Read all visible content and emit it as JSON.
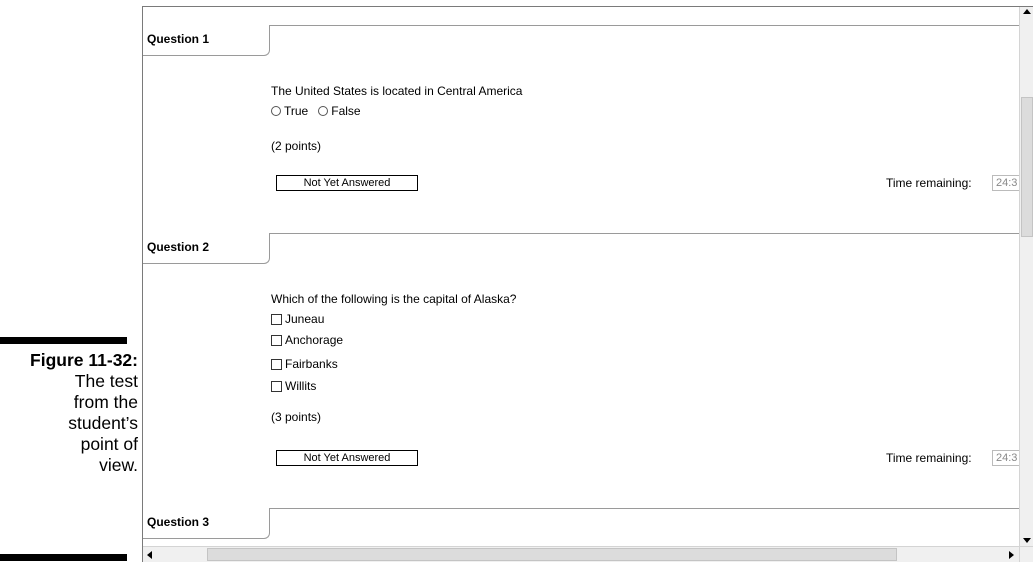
{
  "caption": {
    "figure": "Figure 11-32:",
    "description_lines": [
      "The test",
      "from the",
      "student’s",
      "point of",
      "view."
    ]
  },
  "questions": [
    {
      "title": "Question 1",
      "text": "The United States is located in Central America",
      "type": "radio",
      "options": [
        "True",
        "False"
      ],
      "points": "(2 points)",
      "status": "Not Yet Answered",
      "time_label": "Time remaining:",
      "time_value": "24:3"
    },
    {
      "title": "Question 2",
      "text": "Which of the following is the capital of Alaska?",
      "type": "checkbox",
      "options": [
        "Juneau",
        "Anchorage",
        "Fairbanks",
        "Willits"
      ],
      "points": "(3 points)",
      "status": "Not Yet Answered",
      "time_label": "Time remaining:",
      "time_value": "24:3"
    },
    {
      "title": "Question 3"
    }
  ]
}
